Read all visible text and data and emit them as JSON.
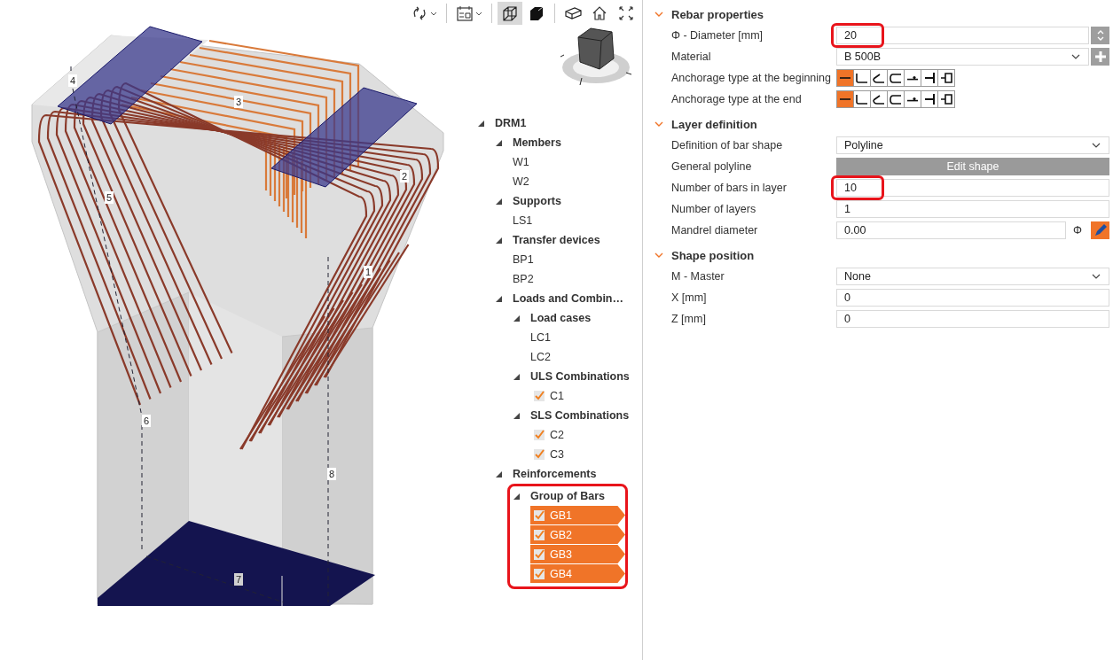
{
  "viewport": {
    "toolbar": [
      {
        "kind": "rotate",
        "selected": false,
        "dropdown": true,
        "separator_before": false
      },
      {
        "kind": "view3d",
        "selected": false,
        "dropdown": true,
        "separator_before": true
      },
      {
        "kind": "wireframe",
        "selected": true,
        "dropdown": false,
        "separator_before": true
      },
      {
        "kind": "solid",
        "selected": false,
        "dropdown": false,
        "separator_before": false
      },
      {
        "kind": "box",
        "selected": false,
        "dropdown": false,
        "separator_before": true
      },
      {
        "kind": "home",
        "selected": false,
        "dropdown": false,
        "separator_before": false
      },
      {
        "kind": "fullscreen",
        "selected": false,
        "dropdown": false,
        "separator_before": false
      }
    ],
    "model_labels": [
      "1",
      "2",
      "3",
      "4",
      "5",
      "6",
      "7",
      "8"
    ],
    "tree": [
      {
        "label": "DRM1",
        "kind": "group",
        "expanded": true,
        "children": [
          {
            "label": "Members",
            "kind": "group",
            "expanded": true,
            "children": [
              {
                "label": "W1",
                "kind": "item",
                "selected": false
              },
              {
                "label": "W2",
                "kind": "item",
                "selected": false
              }
            ]
          },
          {
            "label": "Supports",
            "kind": "group",
            "expanded": true,
            "children": [
              {
                "label": "LS1",
                "kind": "item",
                "selected": false
              }
            ]
          },
          {
            "label": "Transfer devices",
            "kind": "group",
            "expanded": true,
            "children": [
              {
                "label": "BP1",
                "kind": "item",
                "selected": false
              },
              {
                "label": "BP2",
                "kind": "item",
                "selected": false
              }
            ]
          },
          {
            "label": "Loads and Combin…",
            "kind": "group",
            "expanded": true,
            "children": [
              {
                "label": "Load cases",
                "kind": "group",
                "expanded": true,
                "children": [
                  {
                    "label": "LC1",
                    "kind": "item",
                    "selected": false
                  },
                  {
                    "label": "LC2",
                    "kind": "item",
                    "selected": false
                  }
                ]
              },
              {
                "label": "ULS Combinations",
                "kind": "group",
                "expanded": true,
                "children": [
                  {
                    "label": "C1",
                    "kind": "check",
                    "checked": true,
                    "selected": false
                  }
                ]
              },
              {
                "label": "SLS Combinations",
                "kind": "group",
                "expanded": true,
                "children": [
                  {
                    "label": "C2",
                    "kind": "check",
                    "checked": true,
                    "selected": false
                  },
                  {
                    "label": "C3",
                    "kind": "check",
                    "checked": true,
                    "selected": false
                  }
                ]
              }
            ]
          },
          {
            "label": "Reinforcements",
            "kind": "group",
            "expanded": true,
            "children": [
              {
                "label": "Group of Bars",
                "kind": "group",
                "expanded": true,
                "highlighted": true,
                "children": [
                  {
                    "label": "GB1",
                    "kind": "check",
                    "checked": true,
                    "selected": true
                  },
                  {
                    "label": "GB2",
                    "kind": "check",
                    "checked": true,
                    "selected": true
                  },
                  {
                    "label": "GB3",
                    "kind": "check",
                    "checked": true,
                    "selected": true
                  },
                  {
                    "label": "GB4",
                    "kind": "check",
                    "checked": true,
                    "selected": true
                  }
                ]
              }
            ]
          }
        ]
      }
    ]
  },
  "properties": {
    "sections": [
      {
        "title": "Rebar properties",
        "expanded": true,
        "rows": [
          {
            "kind": "spin",
            "label": "Φ - Diameter [mm]",
            "value": "20",
            "highlighted": true
          },
          {
            "kind": "select",
            "label": "Material",
            "value": "B 500B",
            "add_button": true
          },
          {
            "kind": "anchorage",
            "label": "Anchorage type at the beginning",
            "options": [
              {
                "kind": "straight",
                "selected": true
              },
              {
                "kind": "hook90",
                "selected": false
              },
              {
                "kind": "hook135",
                "selected": false
              },
              {
                "kind": "hook180",
                "selected": false
              },
              {
                "kind": "weld",
                "selected": false
              },
              {
                "kind": "plate",
                "selected": false
              },
              {
                "kind": "head",
                "selected": false
              }
            ]
          },
          {
            "kind": "anchorage",
            "label": "Anchorage type at the end",
            "options": [
              {
                "kind": "straight",
                "selected": true
              },
              {
                "kind": "hook90",
                "selected": false
              },
              {
                "kind": "hook135",
                "selected": false
              },
              {
                "kind": "hook180",
                "selected": false
              },
              {
                "kind": "weld",
                "selected": false
              },
              {
                "kind": "plate",
                "selected": false
              },
              {
                "kind": "head",
                "selected": false
              }
            ]
          }
        ]
      },
      {
        "title": "Layer definition",
        "expanded": true,
        "rows": [
          {
            "kind": "select",
            "label": "Definition of bar shape",
            "value": "Polyline",
            "add_button": false
          },
          {
            "kind": "button",
            "label": "General polyline",
            "value": "Edit shape"
          },
          {
            "kind": "text",
            "label": "Number of bars in layer",
            "value": "10",
            "highlighted": true
          },
          {
            "kind": "text",
            "label": "Number of layers",
            "value": "1",
            "highlighted": false
          },
          {
            "kind": "text",
            "label": "Mandrel diameter",
            "value": "0.00",
            "highlighted": false,
            "unit": "Φ",
            "edit_button": true
          }
        ]
      },
      {
        "title": "Shape position",
        "expanded": true,
        "rows": [
          {
            "kind": "select",
            "label": "M - Master",
            "value": "None",
            "add_button": false
          },
          {
            "kind": "text",
            "label": "X [mm]",
            "value": "0",
            "highlighted": false
          },
          {
            "kind": "text",
            "label": "Z [mm]",
            "value": "0",
            "highlighted": false
          }
        ]
      }
    ]
  }
}
